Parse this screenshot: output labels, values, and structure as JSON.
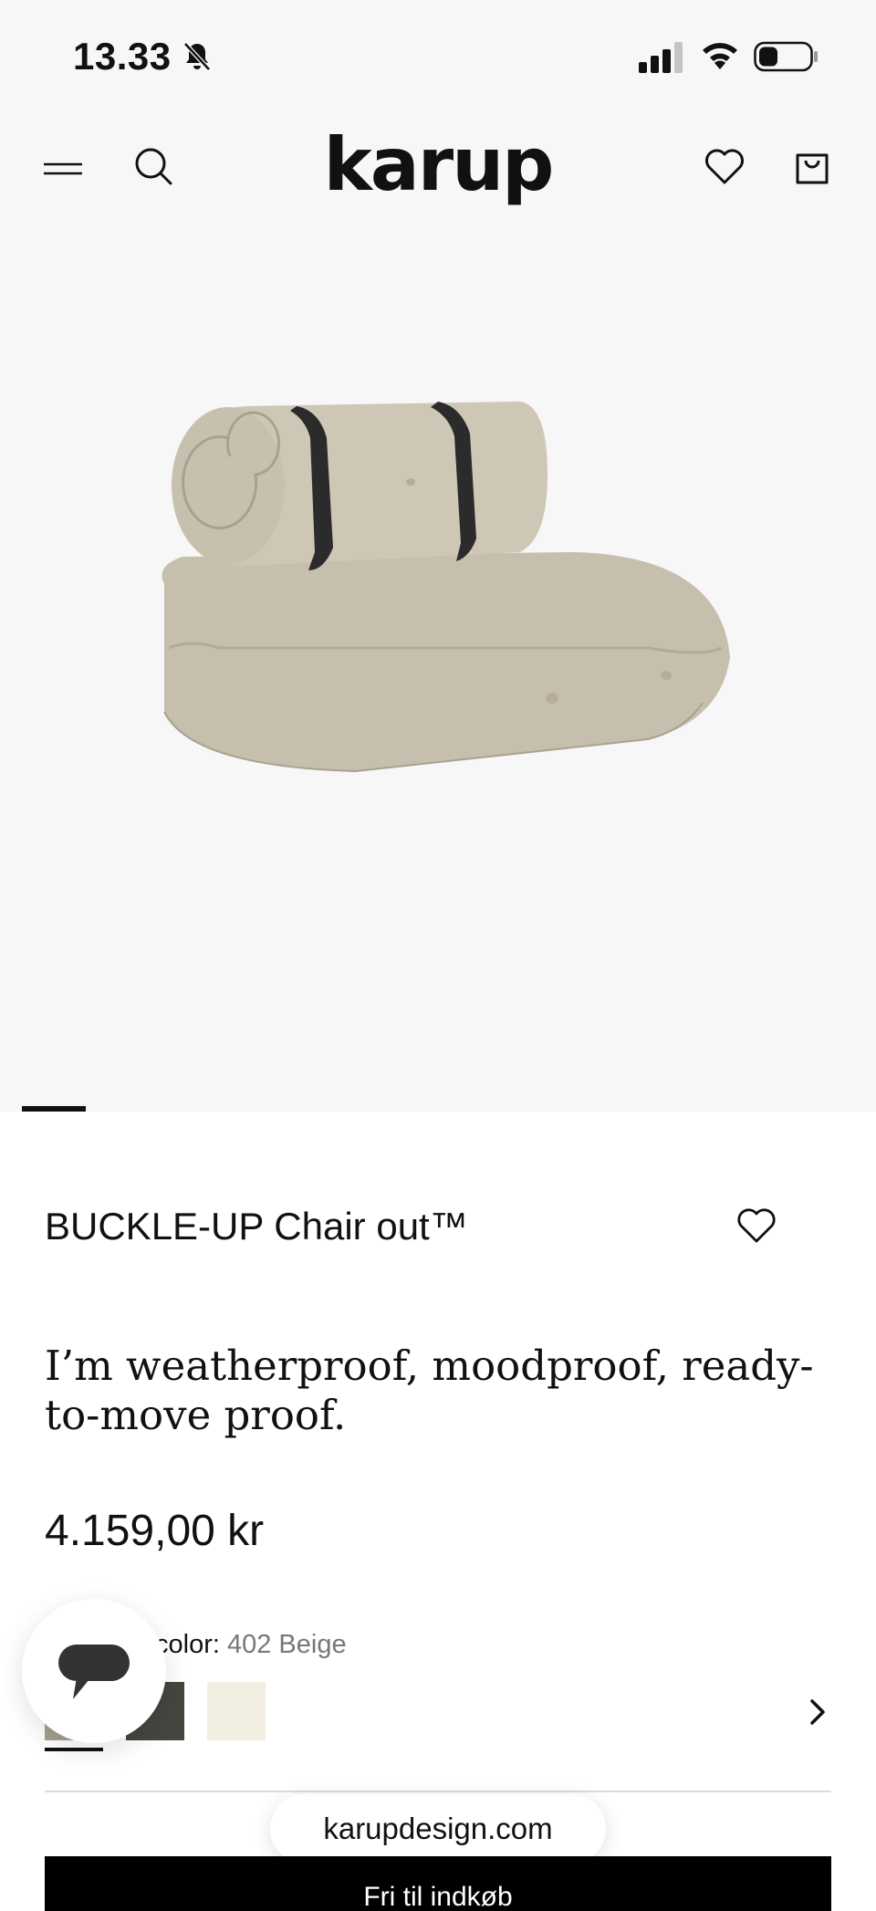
{
  "status_bar": {
    "time": "13.33",
    "icons": [
      "bell-slash-icon",
      "cellular-signal-icon",
      "wifi-icon",
      "battery-icon"
    ]
  },
  "header": {
    "logo_text": "karup",
    "icons": [
      "menu-icon",
      "search-icon",
      "heart-icon",
      "shopping-bag-icon"
    ]
  },
  "gallery": {
    "image_alt": "BUCKLE-UP Chair out beige",
    "active_slide": 1
  },
  "product": {
    "title": "BUCKLE-UP Chair out™",
    "tagline": "I’m weatherproof, moodproof, ready-to-move proof.",
    "price": "4.159,00 kr",
    "color_label": "color:",
    "color_value": "402 Beige",
    "swatches": [
      {
        "name": "Beige",
        "color": "#a7a08f",
        "selected": true
      },
      {
        "name": "Dark Grey",
        "color": "#45463f",
        "selected": false
      },
      {
        "name": "Off-white",
        "color": "#f1ede1",
        "selected": false
      }
    ]
  },
  "browser": {
    "url": "karupdesign.com"
  },
  "bottom_bar": {
    "label": "Fri til indkøb"
  },
  "colors": {
    "header_bg": "#f7f7f7",
    "text": "#111111",
    "muted": "#777777",
    "cta": "#000000"
  }
}
